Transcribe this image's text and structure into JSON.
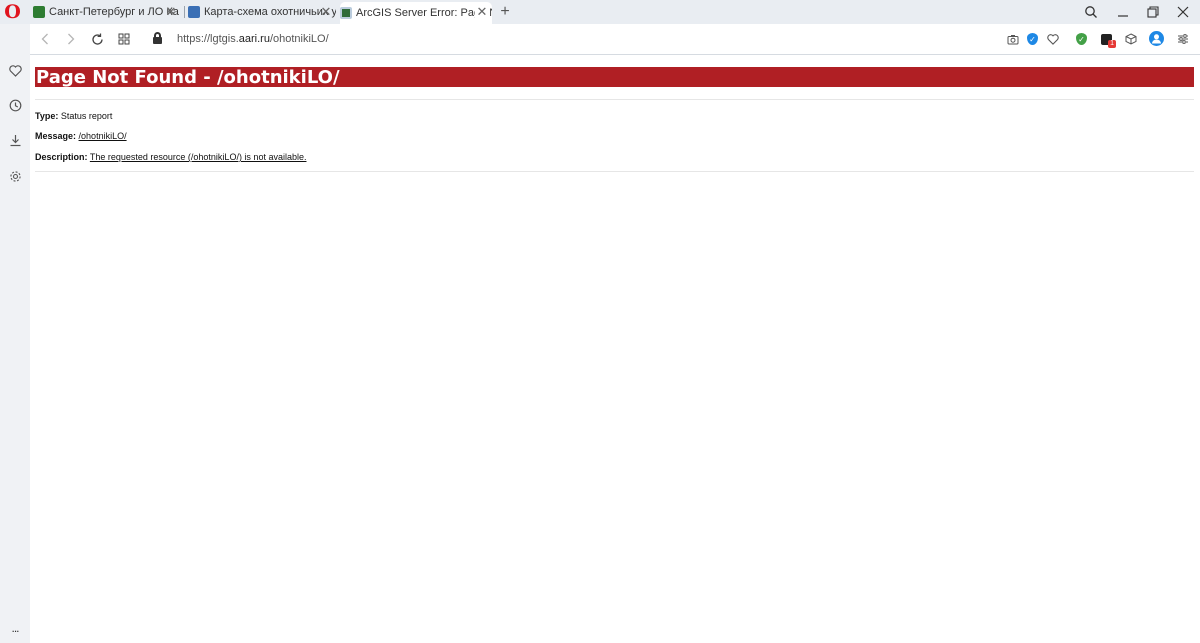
{
  "browser": {
    "logo": "O",
    "tabs": [
      {
        "title": "Санкт-Петербург и ЛО Ка",
        "favicon": "green-ball-icon",
        "active": false
      },
      {
        "title": "Карта-схема охотничьих у",
        "favicon": "map-icon",
        "active": false
      },
      {
        "title": "ArcGIS Server Error: Page N",
        "favicon": "globe-icon",
        "active": true
      }
    ],
    "new_tab_symbol": "+",
    "window_controls": {
      "search": "⌕",
      "minimize": "_",
      "restore": "❐",
      "close": "✕"
    },
    "address": {
      "url_prefix": "https://lgtgis.",
      "url_domain": "aari.ru",
      "url_path": "/ohotnikiLO/"
    },
    "toolbar_icons": [
      "camera-icon",
      "shield-check-icon",
      "heart-icon",
      "adblock-shield-icon",
      "extension-badge-icon",
      "cube-icon",
      "account-icon",
      "settings-sliders-icon"
    ],
    "extension_badge": "1"
  },
  "sidebar": {
    "items": [
      "heart-icon",
      "history-clock-icon",
      "download-icon",
      "settings-gear-icon"
    ],
    "more": "..."
  },
  "page": {
    "title": "Page Not Found - /ohotnikiLO/",
    "type_label": "Type:",
    "type_value": "Status report",
    "message_label": "Message:",
    "message_value": "/ohotnikiLO/",
    "description_label": "Description:",
    "description_value": "The requested resource (/ohotnikiLO/) is not available."
  },
  "colors": {
    "title_bar": "#b01f24",
    "tabstrip": "#e9edf2",
    "opera_red": "#e0141e"
  }
}
